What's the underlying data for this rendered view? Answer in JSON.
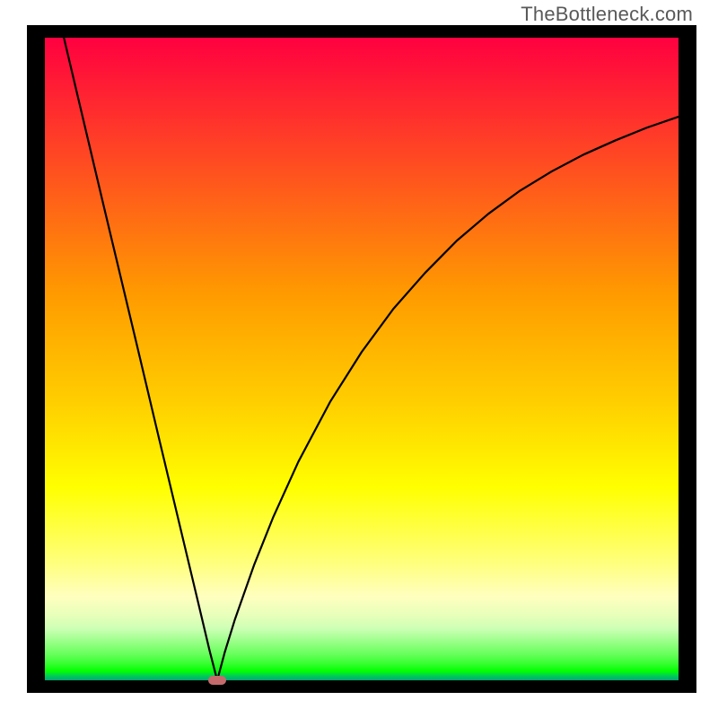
{
  "watermark": "TheBottleneck.com",
  "chart_data": {
    "type": "line",
    "title": "",
    "xlabel": "",
    "ylabel": "",
    "xlim": [
      0,
      100
    ],
    "ylim": [
      0,
      100
    ],
    "grid": false,
    "gradient_stops": [
      {
        "pct": 0,
        "color": "#ff0040"
      },
      {
        "pct": 40,
        "color": "#ff9b00"
      },
      {
        "pct": 70,
        "color": "#ffff00"
      },
      {
        "pct": 92,
        "color": "#ccffb4"
      },
      {
        "pct": 100,
        "color": "#00a878"
      }
    ],
    "minimum_marker": {
      "x": 27.2,
      "y": 0,
      "color": "#c56a6c"
    },
    "series": [
      {
        "name": "bottleneck-curve",
        "points": [
          {
            "x": 3.0,
            "y": 100.0
          },
          {
            "x": 6.0,
            "y": 87.5
          },
          {
            "x": 9.0,
            "y": 75.0
          },
          {
            "x": 12.0,
            "y": 62.6
          },
          {
            "x": 15.0,
            "y": 50.2
          },
          {
            "x": 18.0,
            "y": 37.7
          },
          {
            "x": 21.0,
            "y": 25.3
          },
          {
            "x": 24.0,
            "y": 12.9
          },
          {
            "x": 26.0,
            "y": 4.6
          },
          {
            "x": 27.2,
            "y": 0.0
          },
          {
            "x": 28.4,
            "y": 4.4
          },
          {
            "x": 30.0,
            "y": 9.5
          },
          {
            "x": 33.0,
            "y": 17.9
          },
          {
            "x": 36.0,
            "y": 25.3
          },
          {
            "x": 40.0,
            "y": 34.0
          },
          {
            "x": 45.0,
            "y": 43.3
          },
          {
            "x": 50.0,
            "y": 51.1
          },
          {
            "x": 55.0,
            "y": 57.8
          },
          {
            "x": 60.0,
            "y": 63.4
          },
          {
            "x": 65.0,
            "y": 68.4
          },
          {
            "x": 70.0,
            "y": 72.6
          },
          {
            "x": 75.0,
            "y": 76.2
          },
          {
            "x": 80.0,
            "y": 79.2
          },
          {
            "x": 85.0,
            "y": 81.8
          },
          {
            "x": 90.0,
            "y": 84.0
          },
          {
            "x": 95.0,
            "y": 86.0
          },
          {
            "x": 100.0,
            "y": 87.7
          }
        ]
      }
    ]
  }
}
